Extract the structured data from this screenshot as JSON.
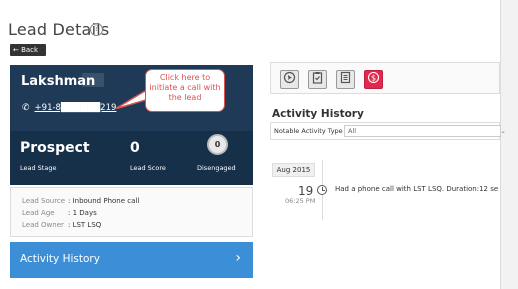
{
  "header": {
    "title": "Lead Details",
    "help_icon": "help-circle-icon",
    "back_label": "← Back"
  },
  "lead": {
    "name": "Lakshman",
    "phone": "+91-8██████219",
    "phone_icon": "phone-icon",
    "callout": "Click here to initiate a call with the lead",
    "stage_value": "Prospect",
    "stage_label": "Lead Stage",
    "score_value": "0",
    "score_label": "Lead Score",
    "engagement_value": "0",
    "engagement_label": "Disengaged"
  },
  "info": {
    "rows": [
      {
        "label": "Lead Source",
        "value": ": Inbound Phone call"
      },
      {
        "label": "Lead Age",
        "value": ": 1 Days"
      },
      {
        "label": "Lead Owner",
        "value": ": LST LSQ"
      }
    ]
  },
  "activity_bar": {
    "label": "Activity History",
    "chevron": "›"
  },
  "toolbar": {
    "icons": [
      "cursor-icon",
      "clipboard-check-icon",
      "document-icon",
      "dollar-icon"
    ]
  },
  "activity": {
    "title": "Activity History",
    "filter_label": "Notable Activity Type",
    "filter_value": "All",
    "month": "Aug 2015",
    "day": "19",
    "time": "06:25 PM",
    "text": "Had a phone call with LST LSQ. Duration:12 se"
  },
  "colors": {
    "card_bg": "#1f3a57",
    "accent_blue": "#3c8fd6",
    "callout_red": "#d9534f",
    "toolbar_red": "#e0294f"
  }
}
